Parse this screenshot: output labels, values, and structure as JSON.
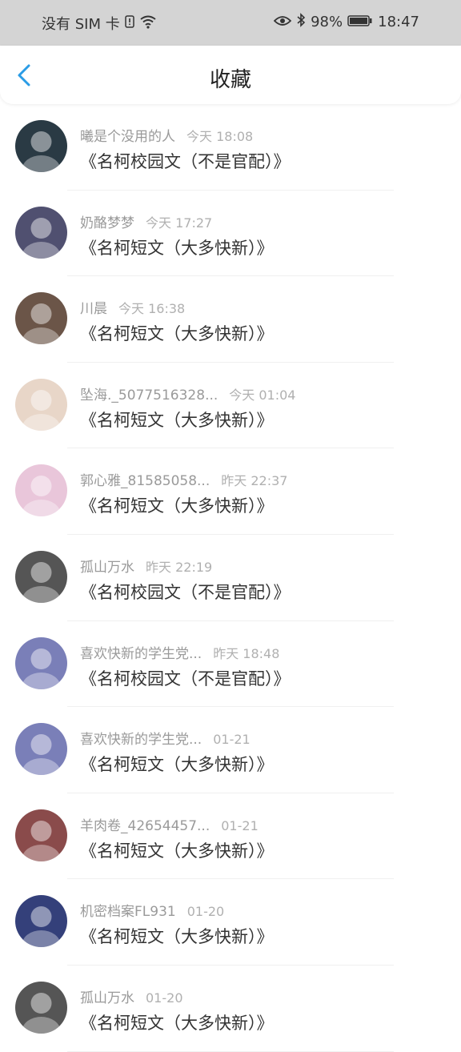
{
  "status": {
    "carrier": "没有 SIM 卡",
    "battery": "98%",
    "time": "18:47"
  },
  "header": {
    "title": "收藏",
    "accent": "#2a9ce6"
  },
  "items": [
    {
      "name": "曦是个没用的人",
      "time": "今天 18:08",
      "text": "《名柯校园文（不是官配）》",
      "avatar": "#2a3a44"
    },
    {
      "name": "奶酪梦梦",
      "time": "今天 17:27",
      "text": "《名柯短文（大多快新）》",
      "avatar": "#505070"
    },
    {
      "name": "川晨",
      "time": "今天 16:38",
      "text": "《名柯短文（大多快新）》",
      "avatar": "#6b5548"
    },
    {
      "name": "坠海._5077516328...",
      "time": "今天 01:04",
      "text": "《名柯短文（大多快新）》",
      "avatar": "#e8d6c8"
    },
    {
      "name": "郭心雅_81585058...",
      "time": "昨天 22:37",
      "text": "《名柯短文（大多快新）》",
      "avatar": "#e9c6da"
    },
    {
      "name": "孤山万水",
      "time": "昨天 22:19",
      "text": "《名柯校园文（不是官配）》",
      "avatar": "#555555"
    },
    {
      "name": "喜欢快新的学生党...",
      "time": "昨天 18:48",
      "text": "《名柯校园文（不是官配）》",
      "avatar": "#7a7fb8"
    },
    {
      "name": "喜欢快新的学生党...",
      "time": "01-21",
      "text": "《名柯短文（大多快新）》",
      "avatar": "#7a7fb8"
    },
    {
      "name": "羊肉卷_42654457...",
      "time": "01-21",
      "text": "《名柯短文（大多快新）》",
      "avatar": "#8a4b4b"
    },
    {
      "name": "机密档案FL931",
      "time": "01-20",
      "text": "《名柯短文（大多快新）》",
      "avatar": "#34407a"
    },
    {
      "name": "孤山万水",
      "time": "01-20",
      "text": "《名柯短文（大多快新）》",
      "avatar": "#555555"
    }
  ]
}
